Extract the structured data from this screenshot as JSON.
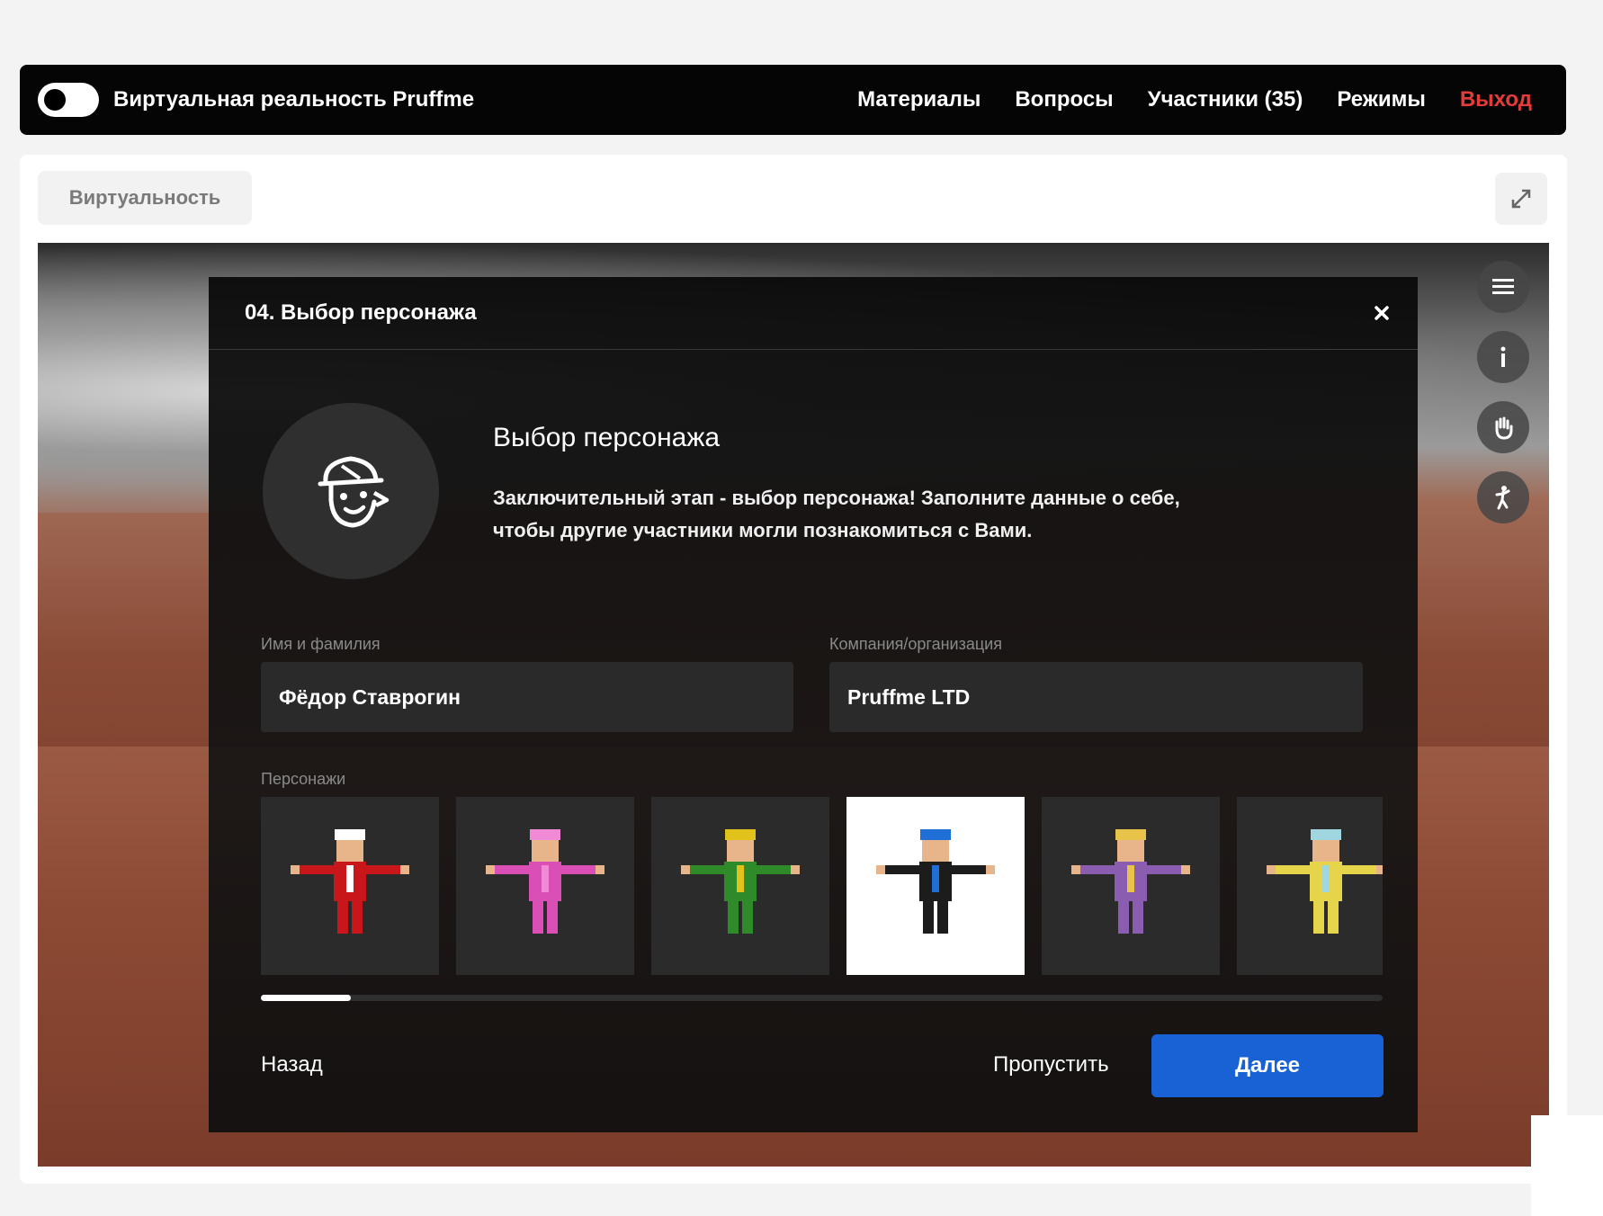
{
  "topbar": {
    "app_title": "Виртуальная реальность Pruffme",
    "nav": [
      "Материалы",
      "Вопросы",
      "Участники (35)",
      "Режимы"
    ],
    "exit_label": "Выход",
    "exit_color": "#e43b3b"
  },
  "panel": {
    "tab_label": "Виртуальность",
    "expand_icon": "expand-icon"
  },
  "side_tools": [
    "menu-icon",
    "info-icon",
    "hand-icon",
    "avatar-pose-icon"
  ],
  "modal": {
    "title": "04. Выбор персонажа",
    "close_icon": "close-icon",
    "heading": "Выбор персонажа",
    "description_line1": "Заключительный этап - выбор персонажа! Заполните данные о себе,",
    "description_line2": "чтобы другие участники могли познакомиться с Вами.",
    "name_label": "Имя и фамилия",
    "name_value": "Фёдор Ставрогин",
    "company_label": "Компания/организация",
    "company_value": "Pruffme LTD",
    "characters_label": "Персонажи",
    "characters": [
      {
        "name": "santa",
        "main": "#c8161b",
        "accent": "#ffffff"
      },
      {
        "name": "bunny",
        "main": "#d94fb5",
        "accent": "#f08ad6"
      },
      {
        "name": "elf",
        "main": "#2f8a2a",
        "accent": "#e1c21a"
      },
      {
        "name": "businessman",
        "main": "#1c1c1c",
        "accent": "#1f6fd6"
      },
      {
        "name": "girl-purple",
        "main": "#8a5db0",
        "accent": "#e8c34a"
      },
      {
        "name": "kid-yellow",
        "main": "#e6d44a",
        "accent": "#9fd6e0"
      }
    ],
    "selected_index": 3,
    "scroll_fraction": 0.08,
    "back_label": "Назад",
    "skip_label": "Пропустить",
    "next_label": "Далее",
    "next_color": "#1862d6"
  }
}
